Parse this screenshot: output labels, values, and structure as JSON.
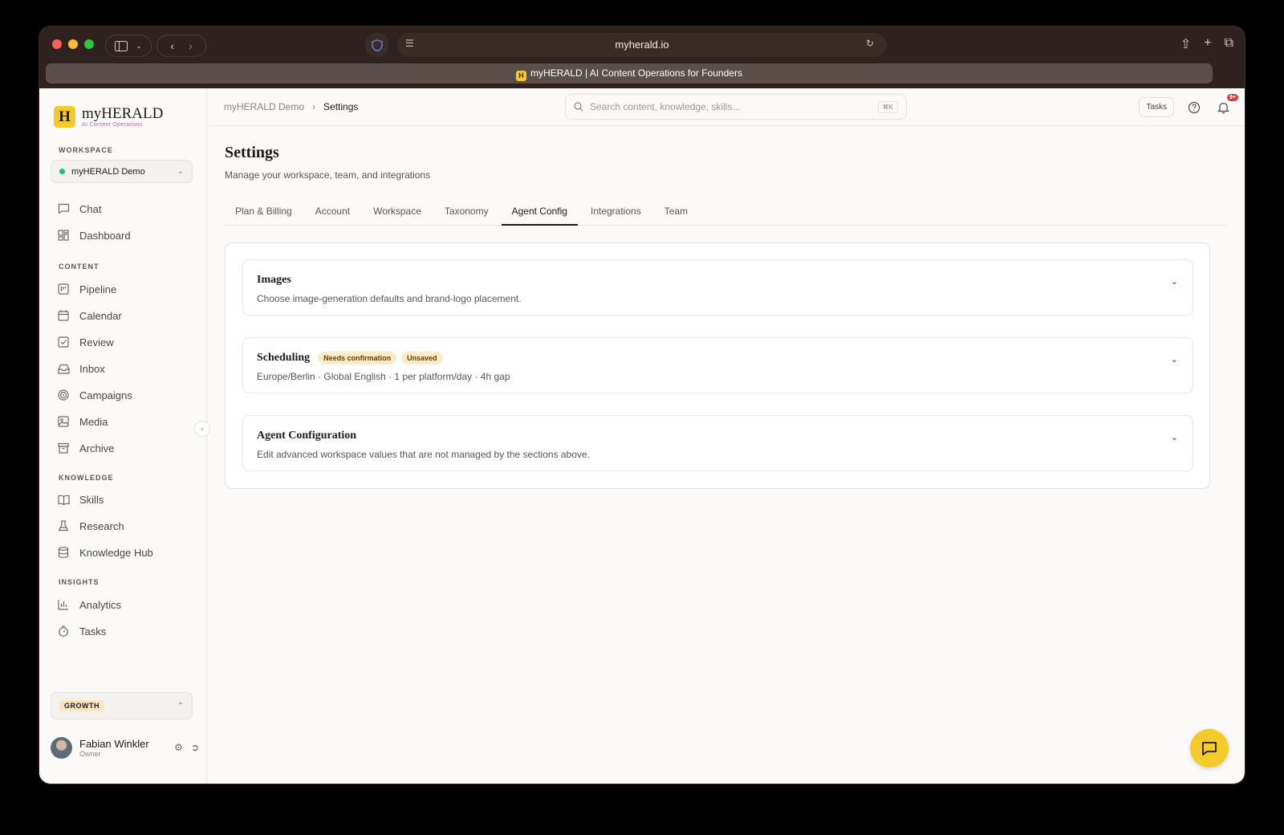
{
  "browser": {
    "url": "myherald.io",
    "tab_title": "myHERALD | AI Content Operations for Founders",
    "favicon_letter": "H"
  },
  "brand": {
    "mark": "H",
    "name": "myHERALD",
    "tagline": "AI Content Operations"
  },
  "sidebar": {
    "workspace_label": "WORKSPACE",
    "workspace_name": "myHERALD Demo",
    "top_items": [
      {
        "label": "Chat",
        "icon": "chat-icon"
      },
      {
        "label": "Dashboard",
        "icon": "dashboard-icon"
      }
    ],
    "content_label": "CONTENT",
    "content_items": [
      {
        "label": "Pipeline",
        "icon": "pipeline-icon"
      },
      {
        "label": "Calendar",
        "icon": "calendar-icon"
      },
      {
        "label": "Review",
        "icon": "review-icon"
      },
      {
        "label": "Inbox",
        "icon": "inbox-icon"
      },
      {
        "label": "Campaigns",
        "icon": "target-icon"
      },
      {
        "label": "Media",
        "icon": "image-icon"
      },
      {
        "label": "Archive",
        "icon": "archive-icon"
      }
    ],
    "knowledge_label": "KNOWLEDGE",
    "knowledge_items": [
      {
        "label": "Skills",
        "icon": "book-icon"
      },
      {
        "label": "Research",
        "icon": "flask-icon"
      },
      {
        "label": "Knowledge Hub",
        "icon": "database-icon"
      }
    ],
    "insights_label": "INSIGHTS",
    "insights_items": [
      {
        "label": "Analytics",
        "icon": "bar-chart-icon"
      },
      {
        "label": "Tasks",
        "icon": "timer-icon"
      }
    ],
    "plan": "GROWTH",
    "user": {
      "name": "Fabian Winkler",
      "role": "Owner"
    }
  },
  "topbar": {
    "breadcrumb_root": "myHERALD Demo",
    "breadcrumb_current": "Settings",
    "search_placeholder": "Search content, knowledge, skills...",
    "search_shortcut": "⌘K",
    "tasks_label": "Tasks",
    "notification_count": "9+"
  },
  "page": {
    "title": "Settings",
    "subtitle": "Manage your workspace, team, and integrations",
    "tabs": [
      "Plan & Billing",
      "Account",
      "Workspace",
      "Taxonomy",
      "Agent Config",
      "Integrations",
      "Team"
    ],
    "active_tab": "Agent Config"
  },
  "cards": [
    {
      "title": "Images",
      "description": "Choose image-generation defaults and brand-logo placement."
    },
    {
      "title": "Scheduling",
      "description": "Europe/Berlin · Global English · 1 per platform/day · 4h gap",
      "badges": [
        "Needs confirmation",
        "Unsaved"
      ]
    },
    {
      "title": "Agent Configuration",
      "description": "Edit advanced workspace values that are not managed by the sections above."
    }
  ],
  "colors": {
    "accent": "#f5cb2c",
    "status_green": "#21c07a",
    "notif_red": "#e5383b",
    "badge_bg": "#fbebc6"
  }
}
